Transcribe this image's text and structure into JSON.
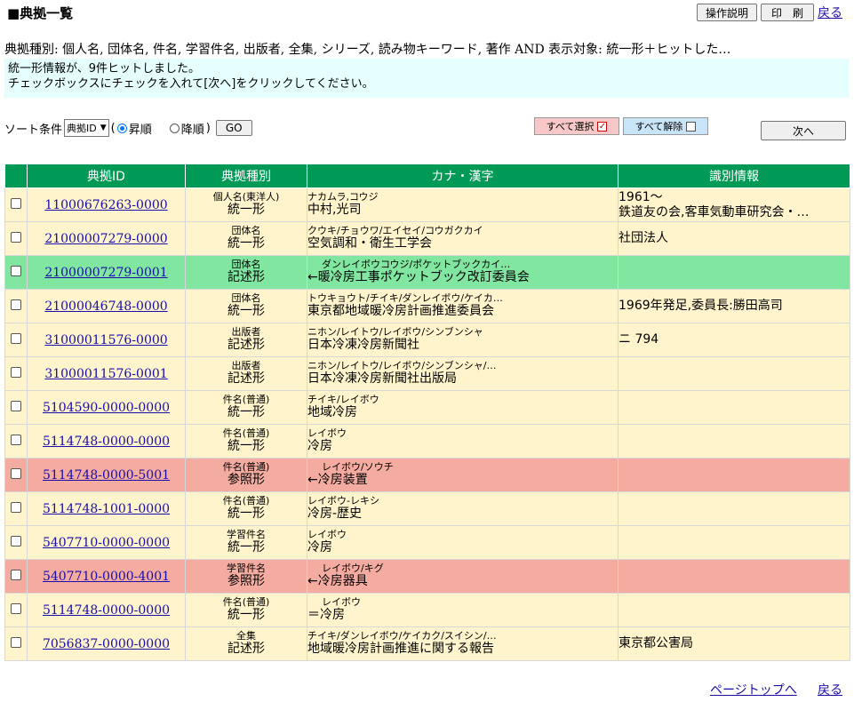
{
  "header": {
    "title": "■典拠一覧",
    "manual_label": "操作説明",
    "print_label": "印　刷",
    "back_label": "戻る"
  },
  "conditions": "典拠種別: 個人名, 団体名, 件名, 学習件名, 出版者, 全集, シリーズ, 読み物キーワード, 著作 AND 表示対象: 統一形＋ヒットした…",
  "message": {
    "line1": "統一形情報が、9件ヒットしました。",
    "line2": "チェックボックスにチェックを入れて[次へ]をクリックしてください。"
  },
  "sort": {
    "label": "ソート条件",
    "selected": "典拠ID",
    "paren_open": "(",
    "asc_label": "昇順",
    "desc_label": "降順",
    "paren_close": ")",
    "go_label": "GO"
  },
  "select_all_label": "すべて選択",
  "clear_all_label": "すべて解除",
  "next_label": "次へ",
  "table": {
    "headers": [
      "典拠ID",
      "典拠種別",
      "カナ・漢字",
      "識別情報"
    ],
    "rows": [
      {
        "id": "11000676263-0000",
        "type_small": "個人名(東洋人)",
        "type_large": "統一形",
        "kana": "ナカムラ,コウジ",
        "kanji": "中村,光司",
        "info1": "1961～",
        "info2": "鉄道友の会,客車気動車研究会・…",
        "style": "normal",
        "indent": false
      },
      {
        "id": "21000007279-0000",
        "type_small": "団体名",
        "type_large": "統一形",
        "kana": "クウキ/チョウワ/エイセイ/コウガクカイ",
        "kanji": "空気調和・衛生工学会",
        "info1": "社団法人",
        "info2": "",
        "style": "normal",
        "indent": false
      },
      {
        "id": "21000007279-0001",
        "type_small": "団体名",
        "type_large": "記述形",
        "kana": "ダンレイボウコウジ/ポケットブックカイ…",
        "kanji": "←暖冷房工事ポケットブック改訂委員会",
        "info1": "",
        "info2": "",
        "style": "green",
        "indent": true
      },
      {
        "id": "21000046748-0000",
        "type_small": "団体名",
        "type_large": "統一形",
        "kana": "トウキョウト/チイキ/ダンレイボウ/ケイカ…",
        "kanji": "東京都地域暖冷房計画推進委員会",
        "info1": "1969年発足,委員長:勝田高司",
        "info2": "",
        "style": "normal",
        "indent": false
      },
      {
        "id": "31000011576-0000",
        "type_small": "出版者",
        "type_large": "記述形",
        "kana": "ニホン/レイトウ/レイボウ/シンブンシャ",
        "kanji": "日本冷凍冷房新聞社",
        "info1": "ニ 794",
        "info2": "",
        "style": "normal",
        "indent": false
      },
      {
        "id": "31000011576-0001",
        "type_small": "出版者",
        "type_large": "記述形",
        "kana": "ニホン/レイトウ/レイボウ/シンブンシャ/…",
        "kanji": "日本冷凍冷房新聞社出版局",
        "info1": "",
        "info2": "",
        "style": "normal",
        "indent": false
      },
      {
        "id": "5104590-0000-0000",
        "type_small": "件名(普通)",
        "type_large": "統一形",
        "kana": "チイキ/レイボウ",
        "kanji": "地域冷房",
        "info1": "",
        "info2": "",
        "style": "normal",
        "indent": false
      },
      {
        "id": "5114748-0000-0000",
        "type_small": "件名(普通)",
        "type_large": "統一形",
        "kana": "レイボウ",
        "kanji": "冷房",
        "info1": "",
        "info2": "",
        "style": "normal",
        "indent": false
      },
      {
        "id": "5114748-0000-5001",
        "type_small": "件名(普通)",
        "type_large": "参照形",
        "kana": "レイボウ/ソウチ",
        "kanji": "←冷房装置",
        "info1": "",
        "info2": "",
        "style": "pink",
        "indent": true
      },
      {
        "id": "5114748-1001-0000",
        "type_small": "件名(普通)",
        "type_large": "統一形",
        "kana": "レイボウ-レキシ",
        "kanji": "冷房-歴史",
        "info1": "",
        "info2": "",
        "style": "normal",
        "indent": false
      },
      {
        "id": "5407710-0000-0000",
        "type_small": "学習件名",
        "type_large": "統一形",
        "kana": "レイボウ",
        "kanji": "冷房",
        "info1": "",
        "info2": "",
        "style": "normal",
        "indent": false
      },
      {
        "id": "5407710-0000-4001",
        "type_small": "学習件名",
        "type_large": "参照形",
        "kana": "レイボウ/キグ",
        "kanji": "←冷房器具",
        "info1": "",
        "info2": "",
        "style": "pink",
        "indent": true
      },
      {
        "id": "5114748-0000-0000",
        "type_small": "件名(普通)",
        "type_large": "統一形",
        "kana": "レイボウ",
        "kanji": "＝冷房",
        "info1": "",
        "info2": "",
        "style": "normal",
        "indent": true
      },
      {
        "id": "7056837-0000-0000",
        "type_small": "全集",
        "type_large": "記述形",
        "kana": "チイキ/ダンレイボウ/ケイカク/スイシン/…",
        "kanji": "地域暖冷房計画推進に関する報告",
        "info1": "東京都公害局",
        "info2": "",
        "style": "normal",
        "indent": false
      }
    ]
  },
  "footer": {
    "pagetop_label": "ページトップへ",
    "back_label": "戻る"
  }
}
